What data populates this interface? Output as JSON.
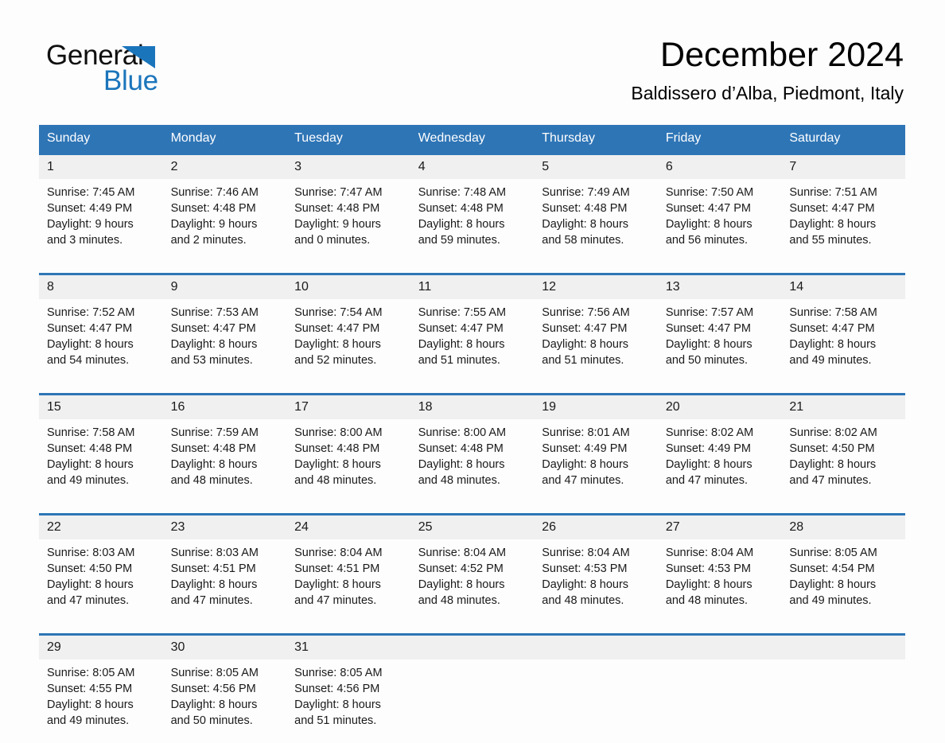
{
  "brand": {
    "name_part1": "General",
    "name_part2": "Blue",
    "logo_icon": "triangle-flag-icon",
    "color_blue": "#1b75bb"
  },
  "header": {
    "title": "December 2024",
    "subtitle": "Baldissero d’Alba, Piedmont, Italy"
  },
  "theme": {
    "header_blue": "#2e75b6",
    "daynum_band": "#f0f0f0",
    "page_background": "#fdfdfd"
  },
  "weekday_headers": [
    "Sunday",
    "Monday",
    "Tuesday",
    "Wednesday",
    "Thursday",
    "Friday",
    "Saturday"
  ],
  "weeks": [
    {
      "days": [
        {
          "date": "1",
          "sunrise": "Sunrise: 7:45 AM",
          "sunset": "Sunset: 4:49 PM",
          "daylight1": "Daylight: 9 hours",
          "daylight2": "and 3 minutes."
        },
        {
          "date": "2",
          "sunrise": "Sunrise: 7:46 AM",
          "sunset": "Sunset: 4:48 PM",
          "daylight1": "Daylight: 9 hours",
          "daylight2": "and 2 minutes."
        },
        {
          "date": "3",
          "sunrise": "Sunrise: 7:47 AM",
          "sunset": "Sunset: 4:48 PM",
          "daylight1": "Daylight: 9 hours",
          "daylight2": "and 0 minutes."
        },
        {
          "date": "4",
          "sunrise": "Sunrise: 7:48 AM",
          "sunset": "Sunset: 4:48 PM",
          "daylight1": "Daylight: 8 hours",
          "daylight2": "and 59 minutes."
        },
        {
          "date": "5",
          "sunrise": "Sunrise: 7:49 AM",
          "sunset": "Sunset: 4:48 PM",
          "daylight1": "Daylight: 8 hours",
          "daylight2": "and 58 minutes."
        },
        {
          "date": "6",
          "sunrise": "Sunrise: 7:50 AM",
          "sunset": "Sunset: 4:47 PM",
          "daylight1": "Daylight: 8 hours",
          "daylight2": "and 56 minutes."
        },
        {
          "date": "7",
          "sunrise": "Sunrise: 7:51 AM",
          "sunset": "Sunset: 4:47 PM",
          "daylight1": "Daylight: 8 hours",
          "daylight2": "and 55 minutes."
        }
      ]
    },
    {
      "days": [
        {
          "date": "8",
          "sunrise": "Sunrise: 7:52 AM",
          "sunset": "Sunset: 4:47 PM",
          "daylight1": "Daylight: 8 hours",
          "daylight2": "and 54 minutes."
        },
        {
          "date": "9",
          "sunrise": "Sunrise: 7:53 AM",
          "sunset": "Sunset: 4:47 PM",
          "daylight1": "Daylight: 8 hours",
          "daylight2": "and 53 minutes."
        },
        {
          "date": "10",
          "sunrise": "Sunrise: 7:54 AM",
          "sunset": "Sunset: 4:47 PM",
          "daylight1": "Daylight: 8 hours",
          "daylight2": "and 52 minutes."
        },
        {
          "date": "11",
          "sunrise": "Sunrise: 7:55 AM",
          "sunset": "Sunset: 4:47 PM",
          "daylight1": "Daylight: 8 hours",
          "daylight2": "and 51 minutes."
        },
        {
          "date": "12",
          "sunrise": "Sunrise: 7:56 AM",
          "sunset": "Sunset: 4:47 PM",
          "daylight1": "Daylight: 8 hours",
          "daylight2": "and 51 minutes."
        },
        {
          "date": "13",
          "sunrise": "Sunrise: 7:57 AM",
          "sunset": "Sunset: 4:47 PM",
          "daylight1": "Daylight: 8 hours",
          "daylight2": "and 50 minutes."
        },
        {
          "date": "14",
          "sunrise": "Sunrise: 7:58 AM",
          "sunset": "Sunset: 4:47 PM",
          "daylight1": "Daylight: 8 hours",
          "daylight2": "and 49 minutes."
        }
      ]
    },
    {
      "days": [
        {
          "date": "15",
          "sunrise": "Sunrise: 7:58 AM",
          "sunset": "Sunset: 4:48 PM",
          "daylight1": "Daylight: 8 hours",
          "daylight2": "and 49 minutes."
        },
        {
          "date": "16",
          "sunrise": "Sunrise: 7:59 AM",
          "sunset": "Sunset: 4:48 PM",
          "daylight1": "Daylight: 8 hours",
          "daylight2": "and 48 minutes."
        },
        {
          "date": "17",
          "sunrise": "Sunrise: 8:00 AM",
          "sunset": "Sunset: 4:48 PM",
          "daylight1": "Daylight: 8 hours",
          "daylight2": "and 48 minutes."
        },
        {
          "date": "18",
          "sunrise": "Sunrise: 8:00 AM",
          "sunset": "Sunset: 4:48 PM",
          "daylight1": "Daylight: 8 hours",
          "daylight2": "and 48 minutes."
        },
        {
          "date": "19",
          "sunrise": "Sunrise: 8:01 AM",
          "sunset": "Sunset: 4:49 PM",
          "daylight1": "Daylight: 8 hours",
          "daylight2": "and 47 minutes."
        },
        {
          "date": "20",
          "sunrise": "Sunrise: 8:02 AM",
          "sunset": "Sunset: 4:49 PM",
          "daylight1": "Daylight: 8 hours",
          "daylight2": "and 47 minutes."
        },
        {
          "date": "21",
          "sunrise": "Sunrise: 8:02 AM",
          "sunset": "Sunset: 4:50 PM",
          "daylight1": "Daylight: 8 hours",
          "daylight2": "and 47 minutes."
        }
      ]
    },
    {
      "days": [
        {
          "date": "22",
          "sunrise": "Sunrise: 8:03 AM",
          "sunset": "Sunset: 4:50 PM",
          "daylight1": "Daylight: 8 hours",
          "daylight2": "and 47 minutes."
        },
        {
          "date": "23",
          "sunrise": "Sunrise: 8:03 AM",
          "sunset": "Sunset: 4:51 PM",
          "daylight1": "Daylight: 8 hours",
          "daylight2": "and 47 minutes."
        },
        {
          "date": "24",
          "sunrise": "Sunrise: 8:04 AM",
          "sunset": "Sunset: 4:51 PM",
          "daylight1": "Daylight: 8 hours",
          "daylight2": "and 47 minutes."
        },
        {
          "date": "25",
          "sunrise": "Sunrise: 8:04 AM",
          "sunset": "Sunset: 4:52 PM",
          "daylight1": "Daylight: 8 hours",
          "daylight2": "and 48 minutes."
        },
        {
          "date": "26",
          "sunrise": "Sunrise: 8:04 AM",
          "sunset": "Sunset: 4:53 PM",
          "daylight1": "Daylight: 8 hours",
          "daylight2": "and 48 minutes."
        },
        {
          "date": "27",
          "sunrise": "Sunrise: 8:04 AM",
          "sunset": "Sunset: 4:53 PM",
          "daylight1": "Daylight: 8 hours",
          "daylight2": "and 48 minutes."
        },
        {
          "date": "28",
          "sunrise": "Sunrise: 8:05 AM",
          "sunset": "Sunset: 4:54 PM",
          "daylight1": "Daylight: 8 hours",
          "daylight2": "and 49 minutes."
        }
      ]
    },
    {
      "days": [
        {
          "date": "29",
          "sunrise": "Sunrise: 8:05 AM",
          "sunset": "Sunset: 4:55 PM",
          "daylight1": "Daylight: 8 hours",
          "daylight2": "and 49 minutes."
        },
        {
          "date": "30",
          "sunrise": "Sunrise: 8:05 AM",
          "sunset": "Sunset: 4:56 PM",
          "daylight1": "Daylight: 8 hours",
          "daylight2": "and 50 minutes."
        },
        {
          "date": "31",
          "sunrise": "Sunrise: 8:05 AM",
          "sunset": "Sunset: 4:56 PM",
          "daylight1": "Daylight: 8 hours",
          "daylight2": "and 51 minutes."
        },
        {
          "date": "",
          "sunrise": "",
          "sunset": "",
          "daylight1": "",
          "daylight2": ""
        },
        {
          "date": "",
          "sunrise": "",
          "sunset": "",
          "daylight1": "",
          "daylight2": ""
        },
        {
          "date": "",
          "sunrise": "",
          "sunset": "",
          "daylight1": "",
          "daylight2": ""
        },
        {
          "date": "",
          "sunrise": "",
          "sunset": "",
          "daylight1": "",
          "daylight2": ""
        }
      ]
    }
  ]
}
